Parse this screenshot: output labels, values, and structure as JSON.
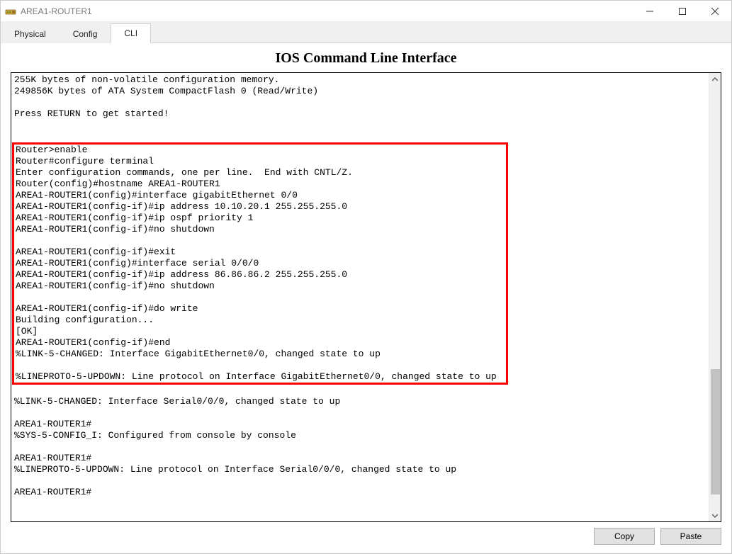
{
  "window": {
    "title": "AREA1-ROUTER1"
  },
  "tabs": {
    "physical": "Physical",
    "config": "Config",
    "cli": "CLI"
  },
  "heading": "IOS Command Line Interface",
  "terminal": {
    "pre": "255K bytes of non-volatile configuration memory.\n249856K bytes of ATA System CompactFlash 0 (Read/Write)\n\nPress RETURN to get started!\n\n\n",
    "highlight": "Router>enable\nRouter#configure terminal\nEnter configuration commands, one per line.  End with CNTL/Z.\nRouter(config)#hostname AREA1-ROUTER1\nAREA1-ROUTER1(config)#interface gigabitEthernet 0/0\nAREA1-ROUTER1(config-if)#ip address 10.10.20.1 255.255.255.0\nAREA1-ROUTER1(config-if)#ip ospf priority 1\nAREA1-ROUTER1(config-if)#no shutdown\n\nAREA1-ROUTER1(config-if)#exit\nAREA1-ROUTER1(config)#interface serial 0/0/0\nAREA1-ROUTER1(config-if)#ip address 86.86.86.2 255.255.255.0\nAREA1-ROUTER1(config-if)#no shutdown\n\nAREA1-ROUTER1(config-if)#do write\nBuilding configuration...\n[OK]\nAREA1-ROUTER1(config-if)#end\n%LINK-5-CHANGED: Interface GigabitEthernet0/0, changed state to up\n\n%LINEPROTO-5-UPDOWN: Line protocol on Interface GigabitEthernet0/0, changed state to up",
    "post": "\n%LINK-5-CHANGED: Interface Serial0/0/0, changed state to up\n\nAREA1-ROUTER1#\n%SYS-5-CONFIG_I: Configured from console by console\n\nAREA1-ROUTER1#\n%LINEPROTO-5-UPDOWN: Line protocol on Interface Serial0/0/0, changed state to up\n\nAREA1-ROUTER1#"
  },
  "buttons": {
    "copy": "Copy",
    "paste": "Paste"
  },
  "scrollbar": {
    "thumb_top_pct": 66,
    "thumb_height_pct": 28
  }
}
